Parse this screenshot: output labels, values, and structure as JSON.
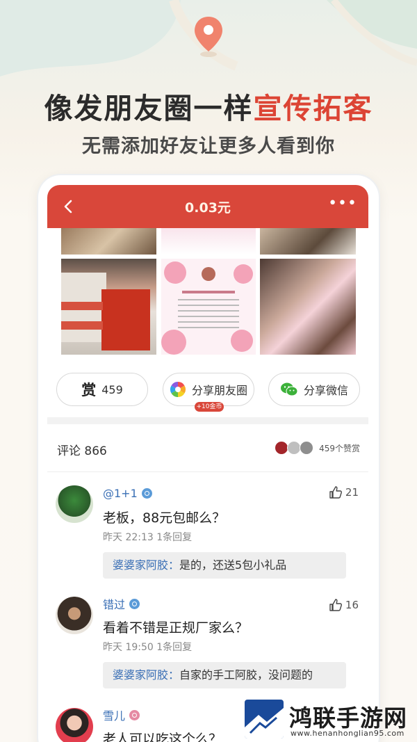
{
  "promo": {
    "headline_part1": "像发朋友圈一样",
    "headline_part2": "宣传拓客",
    "subline": "无需添加好友让更多人看到你"
  },
  "topbar": {
    "title": "0.03元",
    "more_label": "•••"
  },
  "actions": {
    "reward_icon_char": "赏",
    "reward_count": "459",
    "moments_label": "分享朋友圈",
    "moments_badge": "+10金币",
    "wechat_label": "分享微信"
  },
  "comments_header": {
    "label": "评论 866",
    "reward_summary": "459个赞赏"
  },
  "comments": [
    {
      "username": "@1+1",
      "gender": "male",
      "likes": "21",
      "text": "老板，88元包邮么？",
      "meta": "昨天 22:13  1条回复",
      "reply_name": "婆婆家阿胶：",
      "reply_text": "是的，还送5包小礼品"
    },
    {
      "username": "错过",
      "gender": "male",
      "likes": "16",
      "text": "看着不错是正规厂家么？",
      "meta": "昨天 19:50  1条回复",
      "reply_name": "婆婆家阿胶：",
      "reply_text": "自家的手工阿胶，没问题的"
    },
    {
      "username": "雪儿",
      "gender": "female",
      "text": "老人可以吃这个么？"
    }
  ],
  "watermark": {
    "name": "鸿联手游网",
    "url": "www.henanhonglian95.com"
  },
  "colors": {
    "accent": "#d9473a",
    "link": "#3a6fb5"
  }
}
